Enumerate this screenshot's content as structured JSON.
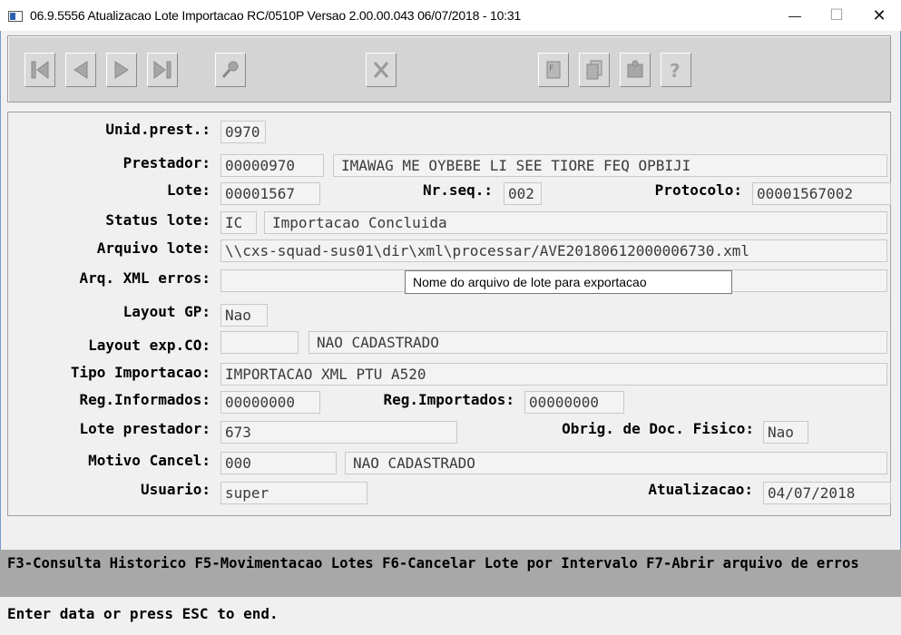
{
  "window": {
    "title": "06.9.5556 Atualizacao  Lote Importacao RC/0510P Versao 2.00.00.043 06/07/2018 - 10:31",
    "minimize_glyph": "—",
    "maximize_glyph": "☐",
    "close_glyph": "✕"
  },
  "toolbar": {
    "buttons": [
      "first-record-icon",
      "previous-record-icon",
      "next-record-icon",
      "last-record-icon",
      "key-icon",
      "cancel-icon",
      "file-icon",
      "copy-icon",
      "puzzle-icon",
      "help-icon"
    ],
    "disabled_color": "#a6a6a6"
  },
  "form": {
    "unid_prest": {
      "label": "Unid.prest.:",
      "value": "0970"
    },
    "prestador": {
      "label": "Prestador:",
      "code": "00000970",
      "name": "IMAWAG ME OYBEBE LI SEE TIORE FEQ OPBIJI"
    },
    "lote": {
      "label": "Lote:",
      "value": "00001567"
    },
    "nr_seq": {
      "label": "Nr.seq.:",
      "value": "002"
    },
    "protocolo": {
      "label": "Protocolo:",
      "value": "00001567002"
    },
    "status_lote": {
      "label": "Status lote:",
      "code": "IC",
      "desc": "Importacao Concluida"
    },
    "arquivo_lote": {
      "label": "Arquivo lote:",
      "value": "\\\\cxs-squad-sus01\\dir\\xml\\processar/AVE20180612000006730.xml"
    },
    "arq_xml_erros": {
      "label": "Arq. XML erros:",
      "value": ""
    },
    "layout_gp": {
      "label": "Layout GP:",
      "value": "Nao"
    },
    "layout_exp_co": {
      "label": "Layout exp.CO:",
      "code": "",
      "desc": "NAO CADASTRADO"
    },
    "tipo_importacao": {
      "label": "Tipo Importacao:",
      "value": "IMPORTACAO XML PTU A520"
    },
    "reg_informados": {
      "label": "Reg.Informados:",
      "value": "00000000"
    },
    "reg_importados": {
      "label": "Reg.Importados:",
      "value": "00000000"
    },
    "lote_prestador": {
      "label": "Lote prestador:",
      "value": "673"
    },
    "obrig_doc": {
      "label": "Obrig. de Doc. Fisico:",
      "value": "Nao"
    },
    "motivo_cancel": {
      "label": "Motivo Cancel:",
      "code": "000",
      "desc": "NAO CADASTRADO"
    },
    "usuario": {
      "label": "Usuario:",
      "value": "super"
    },
    "atualizacao": {
      "label": "Atualizacao:",
      "value": "04/07/2018"
    }
  },
  "tooltip": "Nome do arquivo de lote para exportacao",
  "function_keys": "F3-Consulta Historico F5-Movimentacao Lotes F6-Cancelar Lote por Intervalo F7-Abrir arquivo de erros",
  "status_line": "Enter data or press ESC to end."
}
